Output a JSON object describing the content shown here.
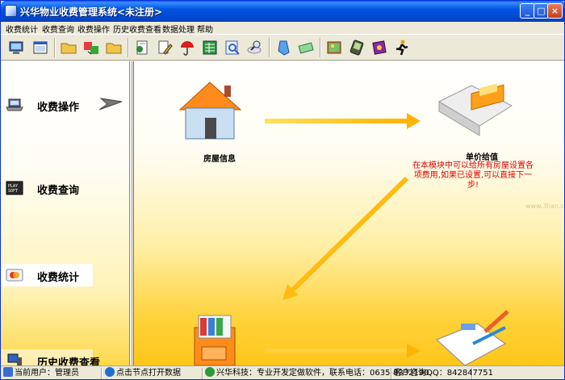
{
  "window": {
    "title": "兴华物业收费管理系统<未注册>",
    "controls": {
      "minimize": "_",
      "maximize": "□",
      "close": "×"
    }
  },
  "menu": [
    {
      "label": "收费统计"
    },
    {
      "label": "收费查询"
    },
    {
      "label": "收费操作"
    },
    {
      "label": "历史收费查看"
    },
    {
      "label": "数据处理"
    },
    {
      "label": "帮助"
    }
  ],
  "toolbar": {
    "icons": [
      "monitor-icon",
      "window-icon",
      "folder-icon",
      "transfer-icon",
      "folder-icon",
      "settings-doc-icon",
      "edit-doc-icon",
      "umbrella-icon",
      "spreadsheet-icon",
      "search-doc-icon",
      "magnifier-icon",
      "document-icon",
      "money-icon",
      "picture-icon",
      "pda-icon",
      "book-icon",
      "run-icon"
    ]
  },
  "nav": {
    "items": [
      {
        "label": "收费操作",
        "icon": "laptop-icon"
      },
      {
        "label": "收费查询",
        "icon": "chip-icon"
      },
      {
        "label": "收费统计",
        "icon": "card-icon",
        "active": true
      },
      {
        "label": "历史收费查看",
        "icon": "pc-icon"
      }
    ]
  },
  "flow": {
    "house_label": "房屋信息",
    "price_label": "单价给值",
    "note": "在本模块中可以给所有房屋设置各项费用,如果已设置,可以直接下一步!",
    "watermark": "www.3lian.com"
  },
  "status": {
    "user": "当前用户：管理员",
    "hint": "点击节点打开数据",
    "company": "兴华科技：专业开发定做软件，联系电话：0635-8332190",
    "qq": "客户咨询QQ：842847751"
  },
  "colors": {
    "accent": "#0054e3",
    "arrow": "#ffc21a",
    "note": "#e00000"
  }
}
